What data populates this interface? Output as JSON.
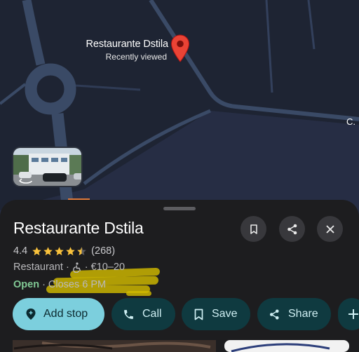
{
  "map": {
    "pin_title": "Restaurante Dstila",
    "pin_subtitle": "Recently viewed",
    "edge_label": "C.",
    "icons": {
      "pin": "location-pin-icon",
      "streetview": "street-view-thumbnail"
    },
    "colors": {
      "land": "#1e2433",
      "road": "#3a4a66",
      "pin": "#ea4335"
    }
  },
  "place": {
    "name": "Restaurante Dstila",
    "rating": "4.4",
    "stars": 4.5,
    "reviews": "(268)",
    "category": "Restaurant",
    "separator": "·",
    "price": "€10–20",
    "open_status": "Open",
    "hours": "Closes 6 PM",
    "icons": [
      "bookmark-icon",
      "share-icon",
      "close-icon",
      "wheelchair-icon",
      "star-icon"
    ]
  },
  "actions": [
    {
      "label": "Add stop",
      "icon": "location-add-icon"
    },
    {
      "label": "Call",
      "icon": "phone-icon"
    },
    {
      "label": "Save",
      "icon": "bookmark-icon"
    },
    {
      "label": "Share",
      "icon": "share-icon"
    },
    {
      "label": "",
      "icon": "plus-icon"
    }
  ],
  "colors": {
    "sheet": "#1d1d1f",
    "open": "#81c995",
    "star": "#f9c23c",
    "primary_button": "#7ccfdd",
    "secondary_button": "#0f3a40",
    "highlight": "#d1ba00"
  }
}
